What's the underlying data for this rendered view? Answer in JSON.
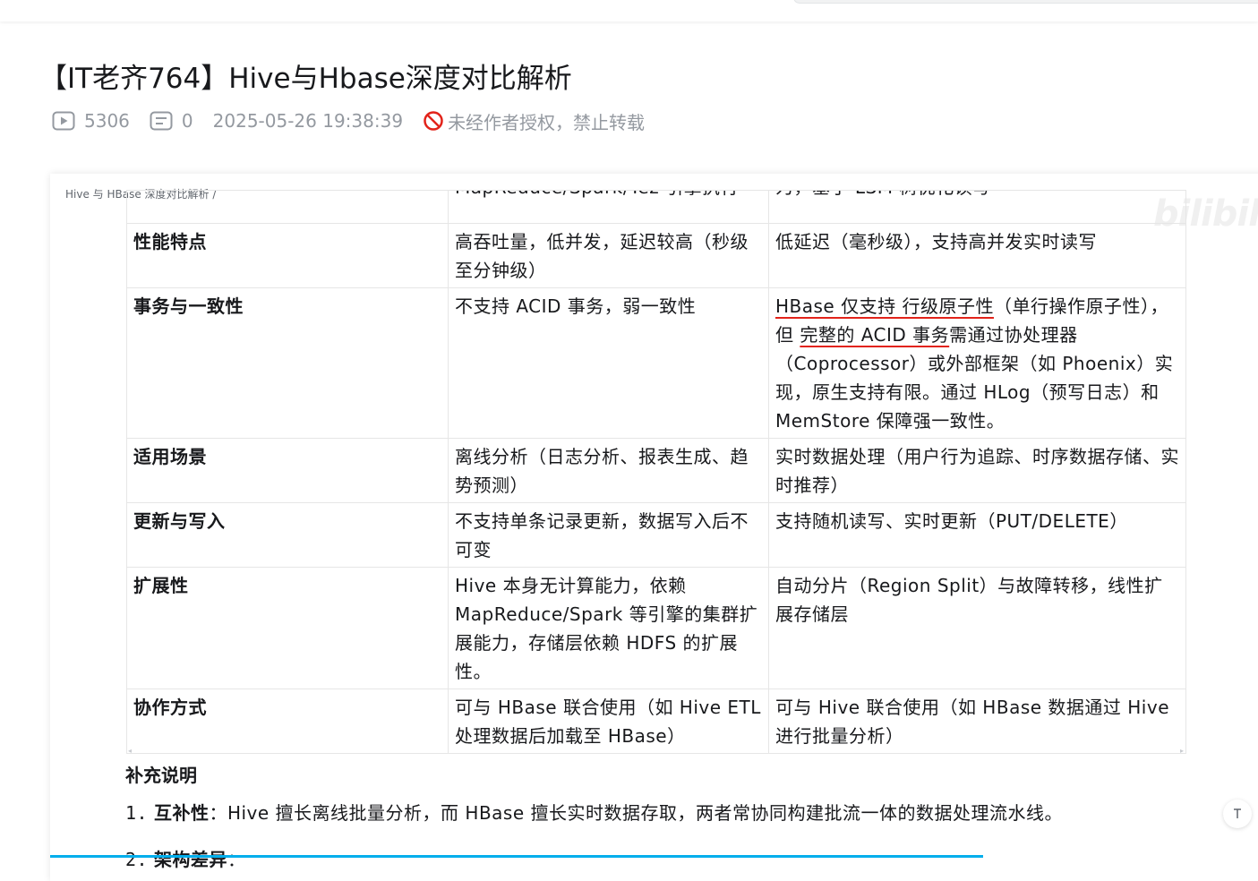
{
  "article": {
    "title": "【IT老齐764】Hive与Hbase深度对比解析",
    "views": "5306",
    "comments": "0",
    "datetime": "2025-05-26 19:38:39",
    "copyright_notice": "未经作者授权，禁止转载"
  },
  "doc": {
    "breadcrumb": "Hive 与 HBase 深度对比解析 /",
    "watermark": "bilibili",
    "table": {
      "cut_row": {
        "c2": "MapReduce/Spark/Tez 引擎执行",
        "c3": "为，基于 LSM 树优化读写"
      },
      "rows": [
        {
          "aspect": "性能特点",
          "hive": "高吞吐量，低并发，延迟较高（秒级至分钟级）",
          "hbase": "低延迟（毫秒级），支持高并发实时读写"
        },
        {
          "aspect": "事务与一致性",
          "hive": "不支持 ACID 事务，弱一致性",
          "hbase_parts": [
            "HBase 仅支持 行级原子性",
            "（单行操作原子性），但 ",
            "完整的 ACID 事务",
            "需通过协处理器（Coprocessor）或外部框架（如 Phoenix）实现，原生支持有限。通过 HLog（预写日志）和 MemStore 保障强一致性。"
          ]
        },
        {
          "aspect": "适用场景",
          "hive": "离线分析（日志分析、报表生成、趋势预测）",
          "hbase": "实时数据处理（用户行为追踪、时序数据存储、实时推荐）"
        },
        {
          "aspect": "更新与写入",
          "hive": "不支持单条记录更新，数据写入后不可变",
          "hbase": "支持随机读写、实时更新（PUT/DELETE）"
        },
        {
          "aspect": "扩展性",
          "hive": "Hive 本身无计算能力，依赖 MapReduce/Spark 等引擎的集群扩展能力，存储层依赖 HDFS 的扩展性。",
          "hbase": "自动分片（Region Split）与故障转移，线性扩展存储层"
        },
        {
          "aspect": "协作方式",
          "hive": "可与 HBase 联合使用（如 Hive ETL 处理数据后加载至 HBase）",
          "hbase": "可与 Hive 联合使用（如 HBase 数据通过 Hive 进行批量分析）"
        }
      ]
    },
    "supplement_title": "补充说明",
    "list": [
      {
        "num": "1.",
        "term": "互补性",
        "text": "：Hive 擅长离线批量分析，而 HBase 擅长实时数据存取，两者常协同构建批流一体的数据处理流水线。"
      },
      {
        "num": "2.",
        "term": "架构差异",
        "text": "："
      }
    ]
  },
  "controls": {
    "to_top_icon": "back-to-top-icon"
  },
  "colors": {
    "accent": "#00aeec",
    "underline": "#e2231a",
    "meta": "#9499a0",
    "ban": "#e2231a"
  }
}
